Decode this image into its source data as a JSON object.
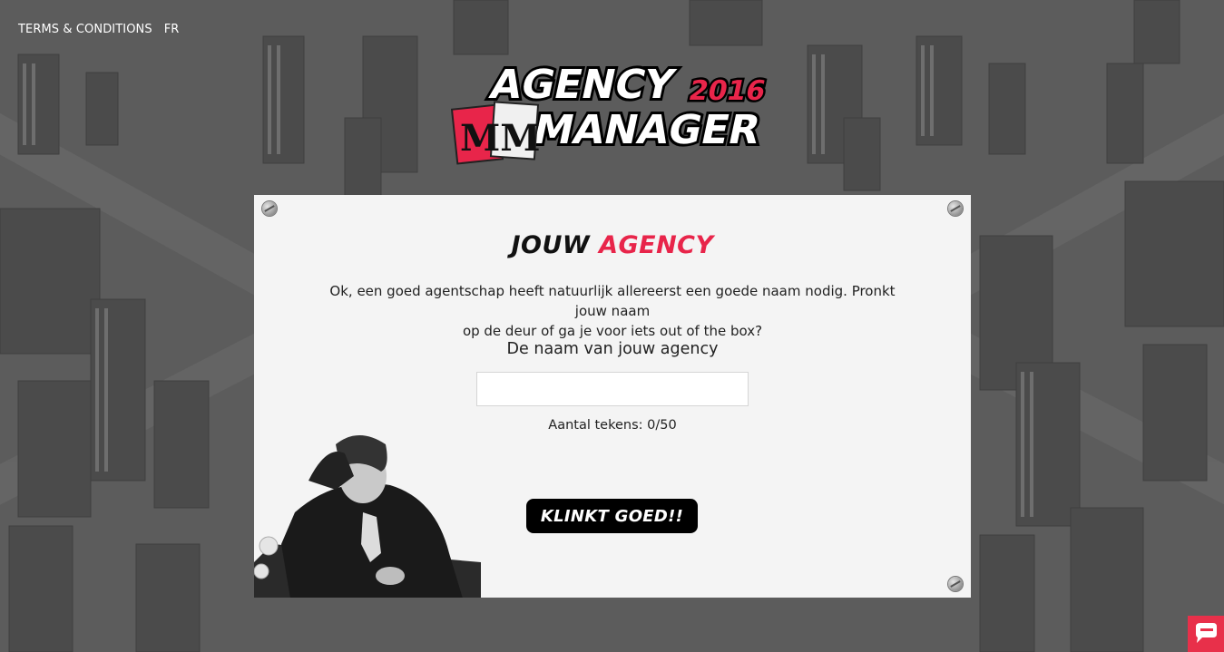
{
  "nav": {
    "terms": "TERMS & CONDITIONS",
    "lang": "FR"
  },
  "logo": {
    "agency": "AGENCY",
    "year": "2016",
    "manager": "MANAGER",
    "badge": "MM"
  },
  "panel": {
    "title_part1": "JOUW",
    "title_part2": "AGENCY",
    "intro_line1": "Ok, een goed agentschap heeft natuurlijk allereerst een goede naam nodig. Pronkt jouw naam",
    "intro_line2": "op de deur of ga je voor iets out of the box?",
    "name_label": "De naam van jouw agency",
    "name_value": "",
    "counter_label": "Aantal tekens: ",
    "counter_value": "0/50",
    "cta_label": "KLINKT GOED!!"
  },
  "colors": {
    "accent": "#e8254a",
    "background": "#5a5a5a",
    "panel": "#f4f4f4"
  },
  "icons": {
    "chat": "chat-widget-icon",
    "screw": "screw-icon"
  }
}
